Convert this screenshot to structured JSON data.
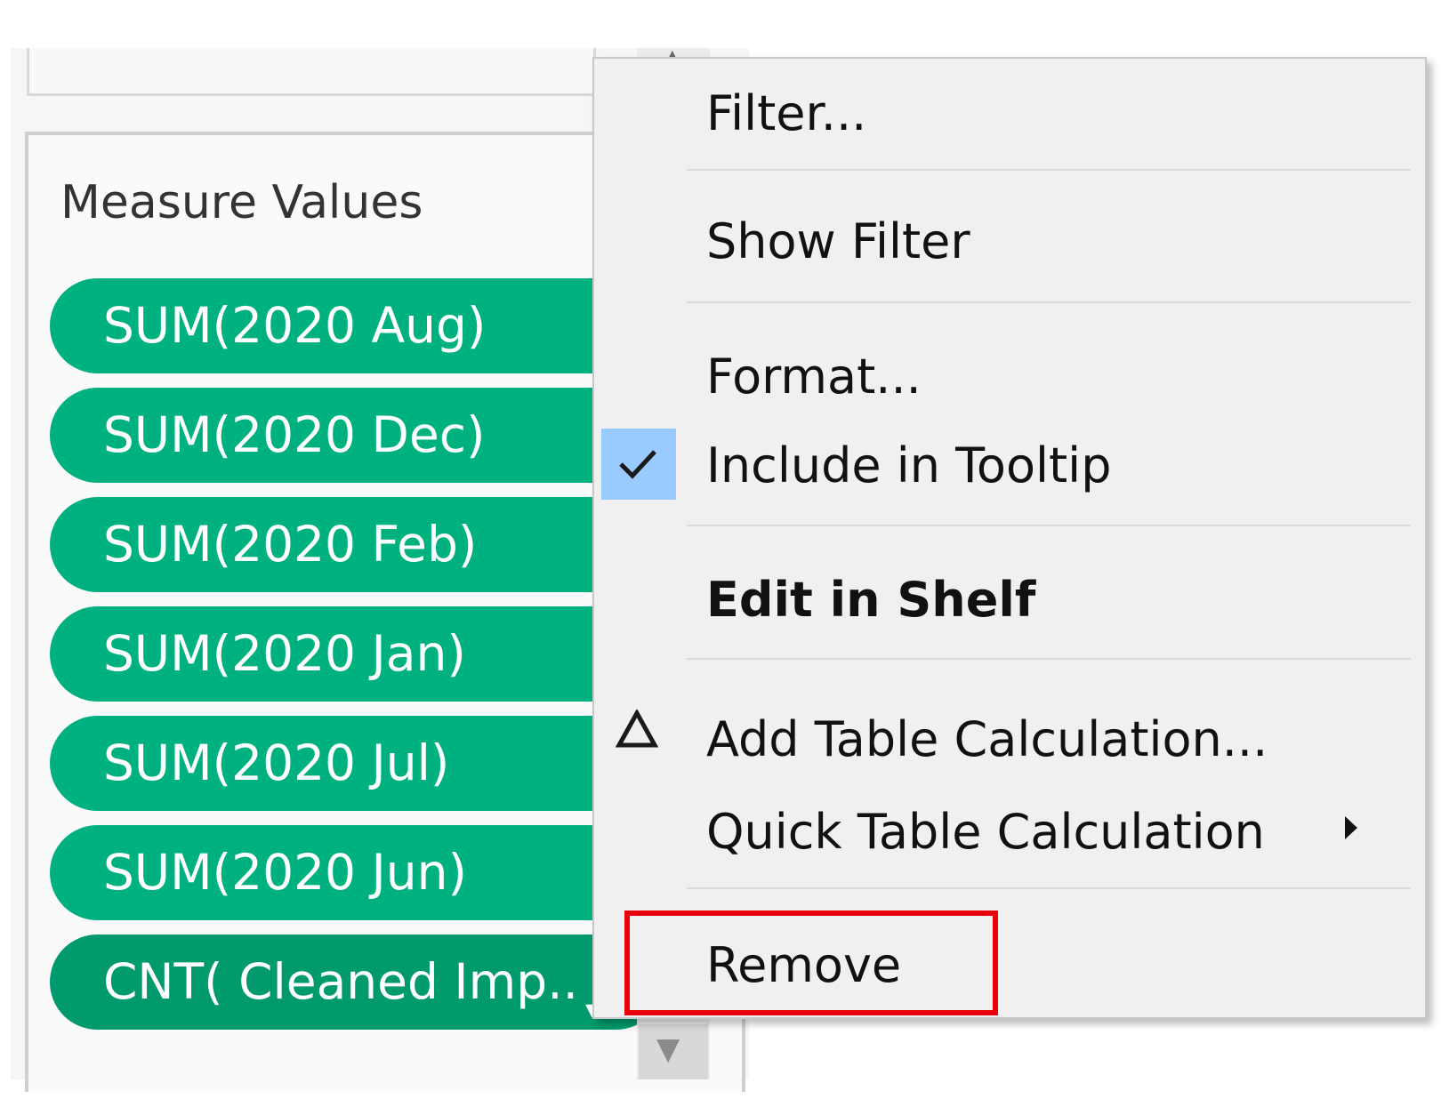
{
  "shelf": {
    "title": "Measure Values",
    "pills": [
      {
        "label": "SUM(2020 Aug)"
      },
      {
        "label": "SUM(2020 Dec)"
      },
      {
        "label": "SUM(2020 Feb)"
      },
      {
        "label": "SUM(2020 Jan)"
      },
      {
        "label": "SUM(2020 Jul)"
      },
      {
        "label": "SUM(2020 Jun)"
      },
      {
        "label": "CNT( Cleaned Imp.."
      }
    ]
  },
  "context_menu": {
    "items": [
      {
        "label": "Filter..."
      },
      {
        "label": "Show Filter"
      },
      {
        "label": "Format..."
      },
      {
        "label": "Include in Tooltip",
        "checked": true
      },
      {
        "label": "Edit in Shelf",
        "bold": true
      },
      {
        "label": "Add Table Calculation...",
        "icon": "delta-icon"
      },
      {
        "label": "Quick Table Calculation",
        "submenu": true
      },
      {
        "label": "Remove",
        "highlighted": true
      }
    ]
  },
  "colors": {
    "pill": "#00b180",
    "pill_selected": "#009a6c",
    "check_highlight": "#99cbff",
    "remove_outline": "#e8000b"
  }
}
